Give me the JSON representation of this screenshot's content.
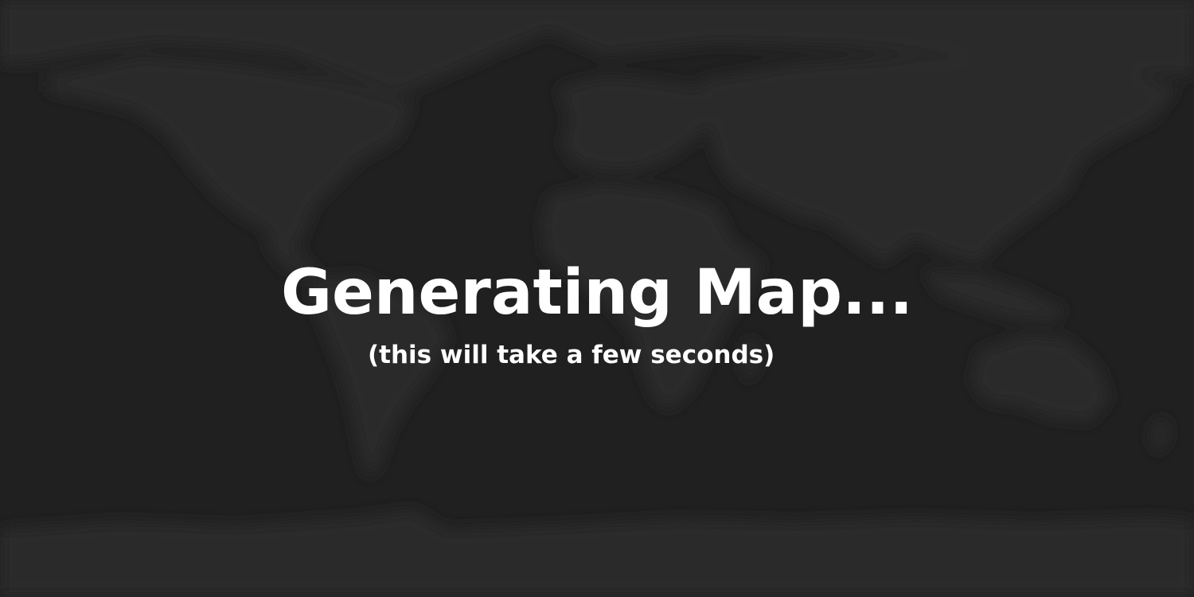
{
  "loading": {
    "title": "Generating Map...",
    "subtitle": "(this will take a few seconds)"
  },
  "colors": {
    "background": "#202020",
    "land": "#2b2b2b",
    "text": "#ffffff"
  },
  "background_image": "blurred-world-map"
}
